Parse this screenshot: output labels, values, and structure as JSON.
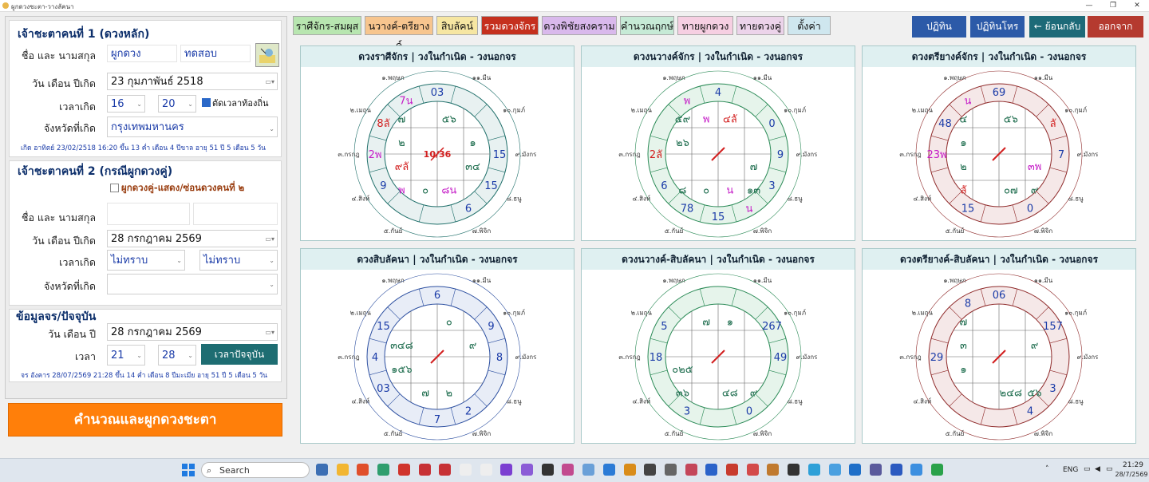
{
  "window": {
    "title": "ผูกดวงชะตา-วางลัคนา"
  },
  "left": {
    "person1": {
      "title": "เจ้าชะตาคนที่ 1 (ดวงหลัก)",
      "name_label": "ชื่อ และ นามสกุล",
      "first_name": "ผูกดวง",
      "last_name": "ทดสอบ",
      "date_label": "วัน เดือน ปีเกิด",
      "date_value": "23  กุมภาพันธ์   2518",
      "time_label": "เวลาเกิด",
      "hour": "16",
      "minute": "20",
      "local_time_label": "ตัดเวลาท้องถิ่น",
      "province_label": "จังหวัดที่เกิด",
      "province": "กรุงเทพมหานคร",
      "info": "เกิด อาทิตย์ 23/02/2518 16:20 ขึ้น 13 ค่ำ เดือน 4 ปีขาล อายุ 51 ปี 5 เดือน 5 วัน"
    },
    "person2": {
      "title": "เจ้าชะตาคนที่ 2 (กรณีผูกดวงคู่)",
      "pair_label": "ผูกดวงคู่-แสดง/ซ่อนดวงคนที่ ๒",
      "name_label": "ชื่อ และ นามสกุล",
      "date_label": "วัน เดือน ปีเกิด",
      "date_value": "28  กรกฎาคม    2569",
      "time_label": "เวลาเกิด",
      "hour": "ไม่ทราบ",
      "minute": "ไม่ทราบ",
      "province_label": "จังหวัดที่เกิด"
    },
    "current": {
      "title": "ข้อมูลจร/ปัจจุบัน",
      "date_label": "วัน เดือน ปี",
      "date_value": "28  กรกฎาคม    2569",
      "time_label": "เวลา",
      "hour": "21",
      "minute": "28",
      "now_button": "เวลาปัจจุบัน",
      "info": "จร อังคาร 28/07/2569 21:28 ขึ้น 14 ค่ำ เดือน 8 ปีมะเมีย อายุ 51 ปี 5 เดือน 5 วัน"
    },
    "calc_button": "คำนวณและผูกดวงชะตา"
  },
  "tabs": [
    {
      "label": "ราศีจักร-สมผุส",
      "color": "#b8e6b0",
      "text": "#111"
    },
    {
      "label": "นวางค์-ตรียางค์",
      "color": "#f7c58e",
      "text": "#111"
    },
    {
      "label": "สิบลัคน์",
      "color": "#f6e6a2",
      "text": "#111"
    },
    {
      "label": "รวมดวงจักร",
      "color": "#c5301e",
      "text": "#ffffff"
    },
    {
      "label": "ดวงพิชัยสงคราม",
      "color": "#d9b9ec",
      "text": "#111"
    },
    {
      "label": "คำนวณฤกษ์",
      "color": "#c6ead6",
      "text": "#111"
    },
    {
      "label": "ทายผูกดวง",
      "color": "#f6cfe2",
      "text": "#111"
    },
    {
      "label": "ทายดวงคู่",
      "color": "#ecd3ea",
      "text": "#111"
    },
    {
      "label": "ตั้งค่า",
      "color": "#cfe7ef",
      "text": "#111"
    }
  ],
  "right_buttons": [
    {
      "label": "ปฏิทิน",
      "color": "#2c5aa8"
    },
    {
      "label": "ปฏิทินโหร",
      "color": "#2c5aa8"
    },
    {
      "label": "← ย้อนกลับ",
      "color": "#1d6a78"
    },
    {
      "label": "ออกจาก",
      "color": "#b53a2f"
    }
  ],
  "houses": [
    "๑.เมษ",
    "๑๑.มีน",
    "๑๐.กุมภ์",
    "๙.มังกร",
    "๘.ธนู",
    "๗.พิจิก",
    "๖.ตุลย์",
    "๕.กันย์",
    "๔.สิงห์",
    "๓.กรกฎ",
    "๒.เมถุน",
    "๑.พฤษภ"
  ],
  "charts": [
    {
      "title": "ดวงราศีจักร | วงในกำเนิด - วงนอกจร",
      "theme": "#1f6f6a",
      "ring": "#e8f1f1",
      "outer": [
        "03",
        "7น",
        "8ลั",
        "2พ",
        "9",
        "",
        "",
        "6",
        "15",
        "15",
        "",
        ""
      ],
      "inner_cells": [
        "๕๖",
        "๑",
        "๓๔",
        "",
        "๘น",
        "๐",
        "พ",
        "๙ลั",
        "๒",
        "๗",
        "",
        ""
      ],
      "center": "10/36"
    },
    {
      "title": "ดวงนวางค์จักร | วงในกำเนิด - วงนอกจร",
      "theme": "#2a8a56",
      "ring": "#e6f4eb",
      "outer": [
        "4",
        "พ",
        "",
        "2ลั",
        "6",
        "78",
        "15",
        "น",
        "3",
        "9",
        "0",
        ""
      ],
      "inner_cells": [
        "๔ลั",
        "",
        "๗",
        "๑๓",
        "น",
        "๐",
        "๘",
        "",
        "๒๖",
        "๕๙",
        "พ",
        ""
      ],
      "center": "/"
    },
    {
      "title": "ดวงตรียางค์จักร | วงในกำเนิด - วงนอกจร",
      "theme": "#8f2a2a",
      "ring": "#f5e8e8",
      "outer": [
        "69",
        "น",
        "48",
        "23พ",
        "",
        "15",
        "",
        "0",
        "",
        "7",
        "ลั",
        ""
      ],
      "inner_cells": [
        "๕๖",
        "",
        "๓พ",
        "๙",
        "๐๗",
        "",
        "ลั",
        "๒",
        "๑",
        "๔",
        "",
        ""
      ],
      "center": "/"
    },
    {
      "title": "ดวงสิบลัคนา | วงในกำเนิด - วงนอกจร",
      "theme": "#2c4fa0",
      "ring": "#e8edf7",
      "outer": [
        "6",
        "",
        "15",
        "4",
        "03",
        "",
        "7",
        "2",
        "",
        "8",
        "9",
        ""
      ],
      "inner_cells": [
        "๐",
        "๙",
        "",
        "",
        "๒",
        "๗",
        "",
        "๑๕๖",
        "๓๔๘",
        "",
        "",
        ""
      ],
      "center": "/"
    },
    {
      "title": "ดวงนวางค์-สิบลัคนา | วงในกำเนิด - วงนอกจร",
      "theme": "#2a8a56",
      "ring": "#e6f4eb",
      "outer": [
        "",
        "",
        "5",
        "18",
        "",
        "3",
        "",
        "0",
        "",
        "49",
        "267",
        ""
      ],
      "inner_cells": [
        "๑",
        "",
        "",
        "๙",
        "๔๘",
        "",
        "๓๖",
        "๐๒๕",
        "",
        "",
        "๗",
        ""
      ],
      "center": "/"
    },
    {
      "title": "ดวงตรียางค์-สิบลัคนา | วงในกำเนิด - วงนอกจร",
      "theme": "#8f2a2a",
      "ring": "#f5e8e8",
      "outer": [
        "06",
        "8",
        "",
        "29",
        "",
        "",
        "",
        "4",
        "3",
        "",
        "157",
        ""
      ],
      "inner_cells": [
        "",
        "๙",
        "",
        "๕๖",
        "๒๔๘",
        "",
        "",
        "๑",
        "๓",
        "๗",
        "",
        ""
      ],
      "center": "/"
    }
  ],
  "taskbar": {
    "search": "Search",
    "lang": "ENG",
    "time": "21:29",
    "date": "28/7/2569"
  }
}
